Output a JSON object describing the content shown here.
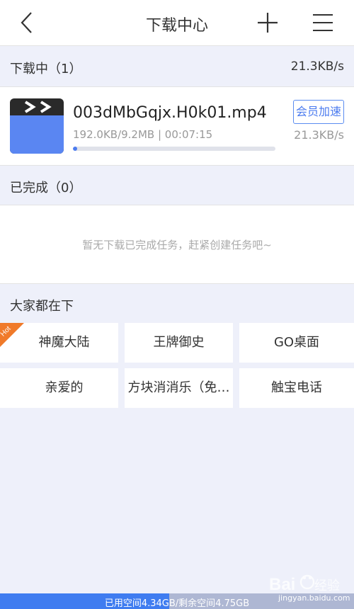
{
  "nav": {
    "title": "下载中心",
    "back_icon": "chevron-left-icon",
    "add_icon": "plus-icon",
    "menu_icon": "menu-icon"
  },
  "downloading": {
    "header": "下载中（1）",
    "total_speed": "21.3KB/s",
    "item": {
      "icon": "video-clapper-icon",
      "filename": "003dMbGqjx.H0k01.mp4",
      "meta": "192.0KB/9.2MB | 00:07:15",
      "progress": 0.021,
      "vip_label": "会员加速",
      "speed": "21.3KB/s"
    }
  },
  "completed": {
    "header": "已完成（0）",
    "empty_text": "暂无下载已完成任务，赶紧创建任务吧~"
  },
  "popular": {
    "header": "大家都在下",
    "hot_label": "Hot",
    "items": [
      "神魔大陆",
      "王牌御史",
      "GO桌面",
      "亲爱的",
      "方块消消乐（免…",
      "触宝电话"
    ]
  },
  "storage": {
    "label": "已用空间4.34GB/剩余空间4.75GB",
    "used_fraction": 0.477
  },
  "watermark": {
    "text": "Baidu经验",
    "sub": "jingyan.baidu.com"
  },
  "colors": {
    "accent": "#4b7bef",
    "hot": "#f07a2a",
    "page_bg": "#eef0fa"
  }
}
